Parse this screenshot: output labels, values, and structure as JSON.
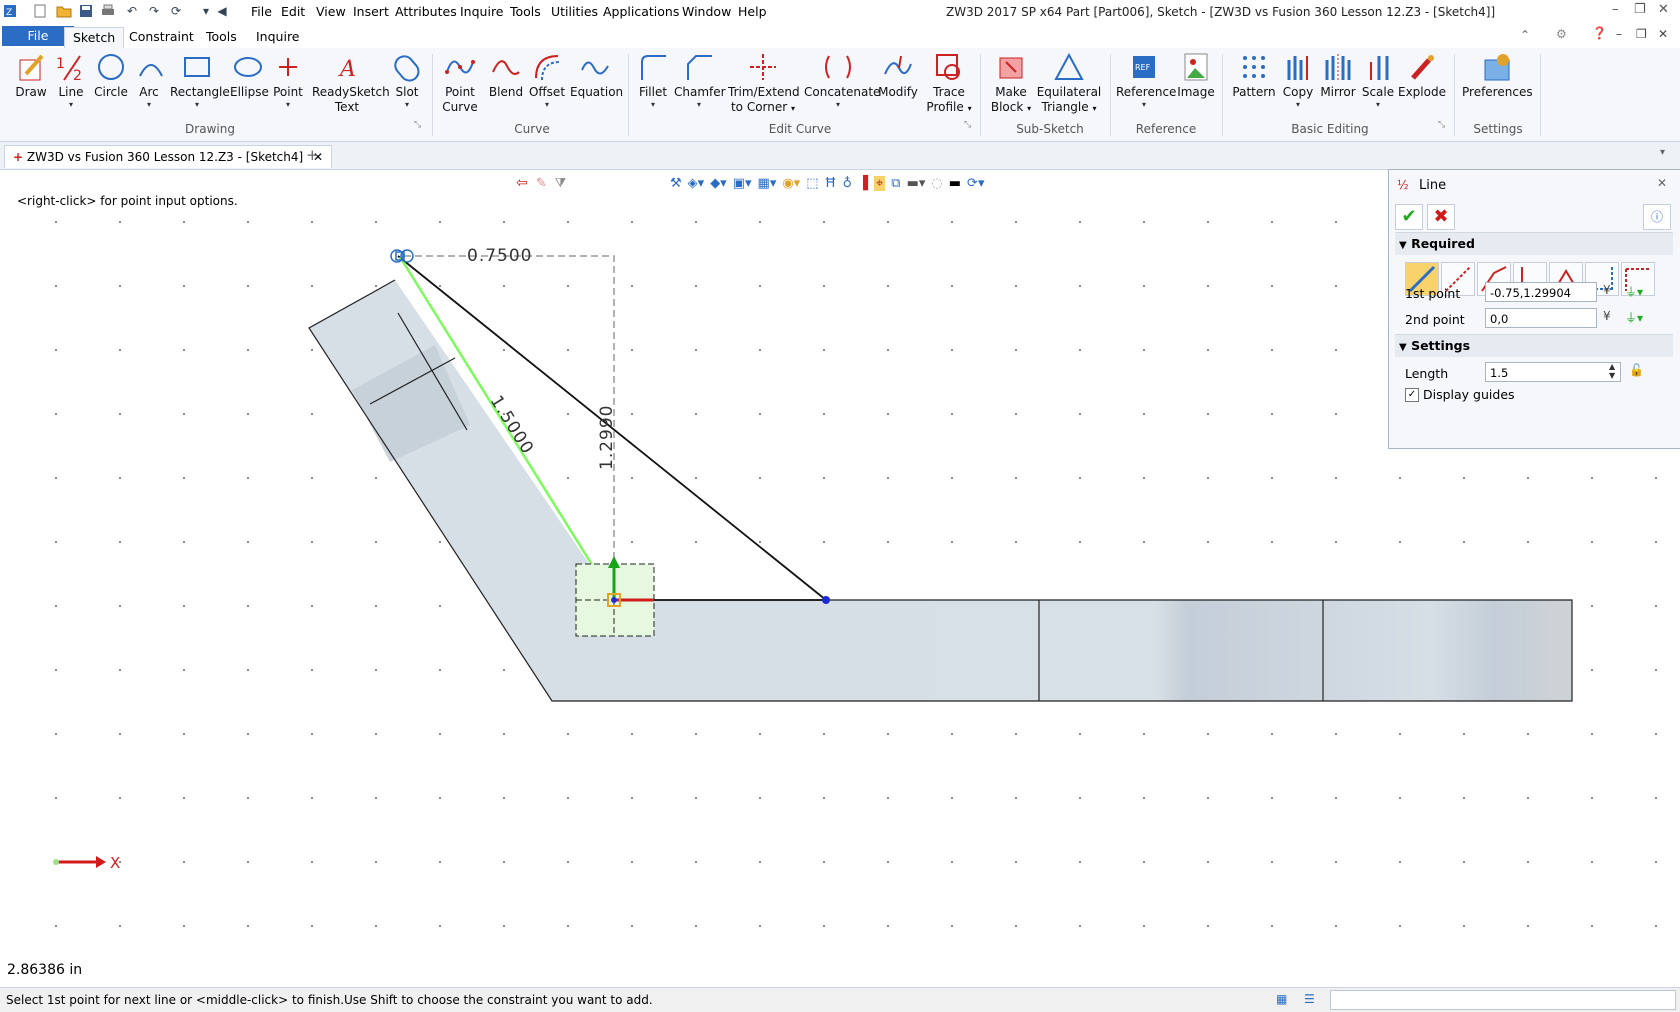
{
  "titlebar": {
    "app": "ZW3D 2017 SP x64",
    "doc": "Part [Part006],  Sketch - [ZW3D vs Fusion 360 Lesson 12.Z3 - [Sketch4]]",
    "menu": [
      "File",
      "Edit",
      "View",
      "Insert",
      "Attributes",
      "Inquire",
      "Tools",
      "Utilities",
      "Applications",
      "Window",
      "Help"
    ]
  },
  "ribbon_tabs": [
    "File",
    "Sketch",
    "Constraint",
    "Tools",
    "Inquire"
  ],
  "ribbon": {
    "drawing": {
      "label": "Drawing",
      "buttons": [
        "Draw",
        "Line",
        "Circle",
        "Arc",
        "Rectangle",
        "Ellipse",
        "Point",
        "ReadySketch",
        "Text",
        "Slot"
      ]
    },
    "curve": {
      "label": "Curve",
      "buttons": [
        "Point",
        "Curve",
        "Blend",
        "Offset",
        "Equation"
      ]
    },
    "edit_curve": {
      "label": "Edit Curve",
      "buttons": [
        "Fillet",
        "Chamfer",
        "Trim/Extend",
        "to Corner",
        "Concatenate",
        "Modify",
        "Trace",
        "Profile"
      ]
    },
    "sub_sketch": {
      "label": "Sub-Sketch",
      "buttons": [
        "Make",
        "Block",
        "Equilateral",
        "Triangle"
      ]
    },
    "reference": {
      "label": "Reference",
      "buttons": [
        "Reference",
        "Image"
      ]
    },
    "basic_editing": {
      "label": "Basic Editing",
      "buttons": [
        "Pattern",
        "Copy",
        "Mirror",
        "Scale",
        "Explode"
      ]
    },
    "settings": {
      "label": "Settings",
      "buttons": [
        "Preferences"
      ]
    }
  },
  "doc_tab": "ZW3D vs Fusion 360 Lesson 12.Z3 - [Sketch4]",
  "canvas": {
    "hint": "<right-click> for point input options.",
    "dim_horizontal": "0.7500",
    "dim_length": "1.5000",
    "dim_vertical": "1.2990",
    "axis_label": "X",
    "distance_readout": "2.86386 in"
  },
  "panel": {
    "title": "Line",
    "required_label": "Required",
    "first_point_label": "1st point",
    "first_point_value": "-0.75,1.29904",
    "second_point_label": "2nd point",
    "second_point_value": "0,0",
    "settings_label": "Settings",
    "length_label": "Length",
    "length_value": "1.5",
    "display_guides_label": "Display guides",
    "display_guides_checked": true
  },
  "status": {
    "text": "Select 1st point for next line or <middle-click> to finish.Use Shift to choose the constraint you want to add."
  },
  "colors": {
    "accent": "#2b6cc4",
    "guide_green": "#7CFC5C",
    "red": "#d11a1a"
  }
}
